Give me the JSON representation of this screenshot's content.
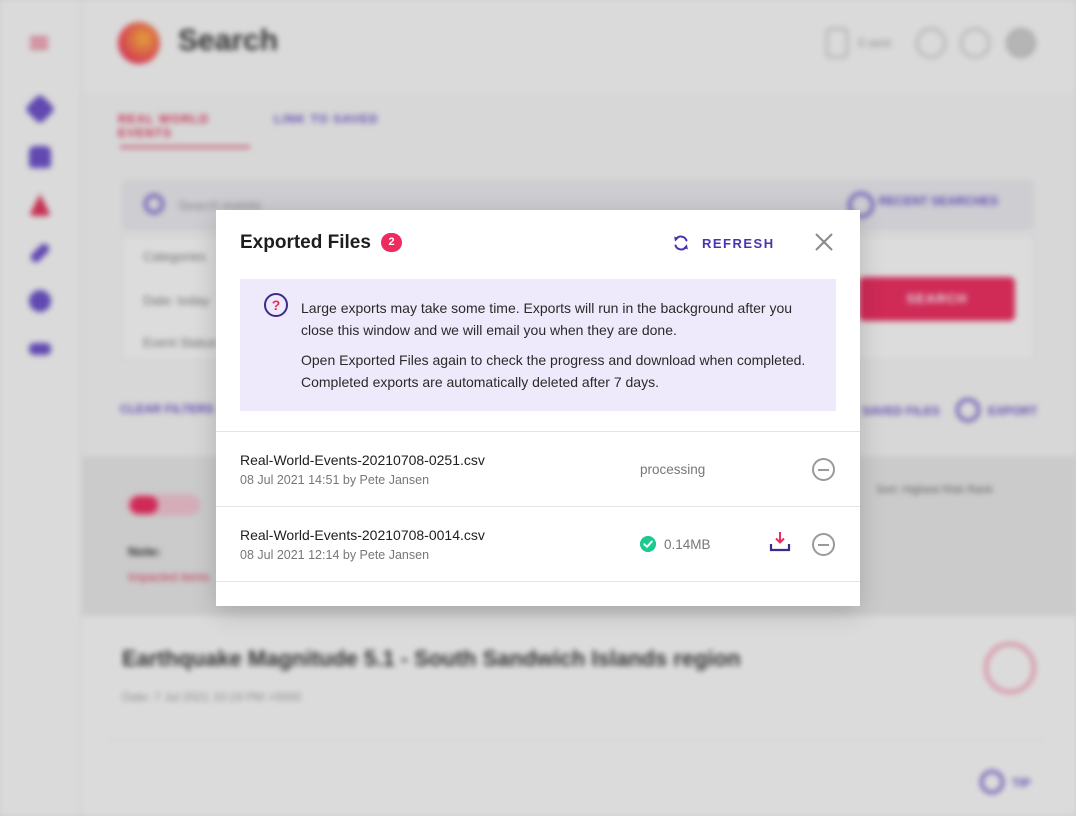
{
  "background": {
    "page_title": "Search",
    "top_user": "0 sent",
    "tabs": [
      "REAL WORLD EVENTS",
      "LINK TO SAVED"
    ],
    "search_placeholder": "Search events",
    "saved_searches": "RECENT SEARCHES",
    "filters": [
      "Categories",
      "Date: today",
      "Event Status"
    ],
    "search_button": "SEARCH",
    "clear_filters": "CLEAR FILTERS",
    "saved_files": "SAVED FILES",
    "export": "EXPORT",
    "sort_label": "Sort: Highest Risk Rank",
    "note_label": "Note:",
    "note_sub": "Impacted items",
    "event_title": "Earthquake Magnitude 5.1 - South Sandwich Islands region",
    "event_meta": "Date: 7 Jul 2021 10:19 PM +0000",
    "fab_label": "TIP"
  },
  "modal": {
    "title": "Exported Files",
    "count": "2",
    "refresh_label": "REFRESH",
    "info": {
      "paragraph1": "Large exports may take some time. Exports will run in the background after you close this window and we will email you when they are done.",
      "paragraph2": "Open Exported Files again to check the progress and download when completed. Completed exports are automatically deleted after 7 days."
    },
    "files": [
      {
        "name": "Real-World-Events-20210708-0251.csv",
        "meta": "08 Jul 2021 14:51 by Pete Jansen",
        "status": "processing"
      },
      {
        "name": "Real-World-Events-20210708-0014.csv",
        "meta": "08 Jul 2021 12:14 by Pete Jansen",
        "size": "0.14MB"
      }
    ]
  },
  "colors": {
    "accent": "#ec2b5f",
    "primary": "#4a35b0",
    "info_bg": "#eeeafb",
    "success": "#1dc98c"
  }
}
